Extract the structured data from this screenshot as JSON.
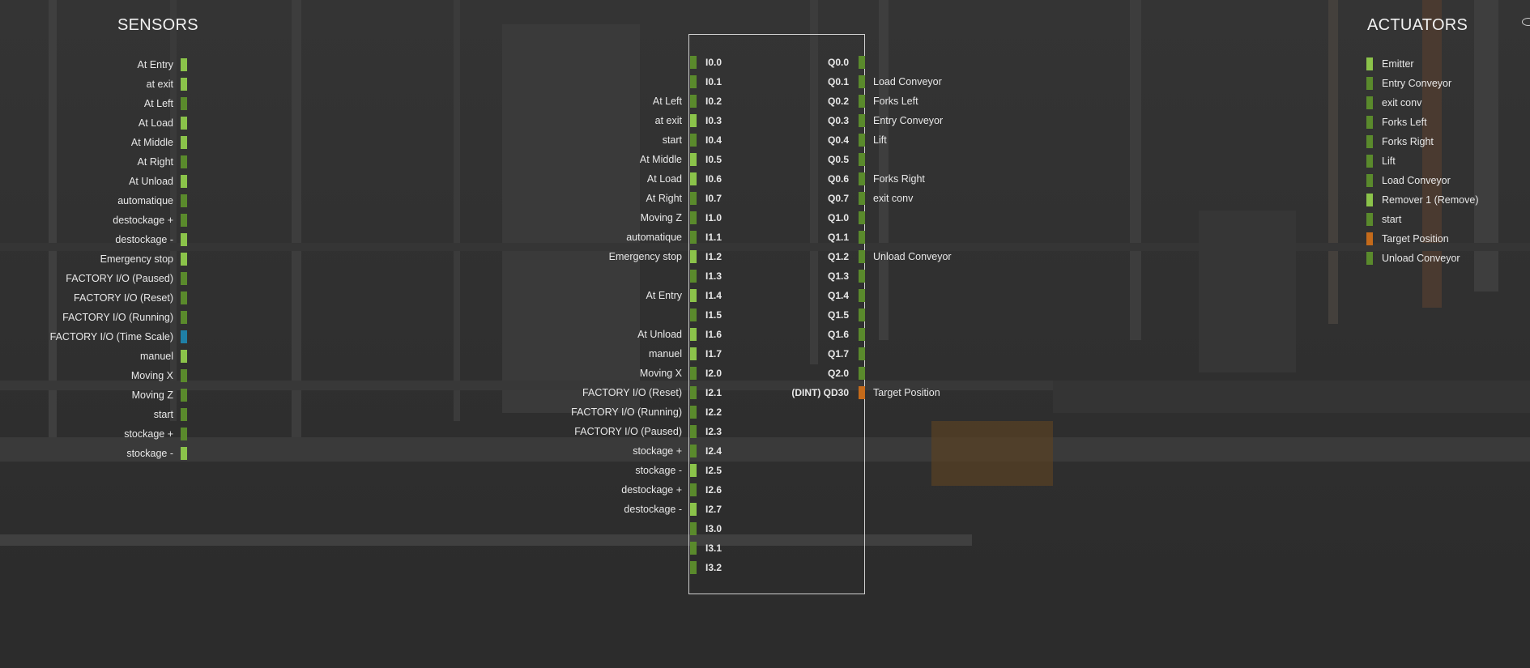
{
  "colors": {
    "on": "#8bc34a",
    "off": "#5a8a2c",
    "analog_orange": "#c46a1a",
    "analog_blue": "#1f7fa6"
  },
  "sensors": {
    "title": "SENSORS",
    "items": [
      {
        "label": "At Entry",
        "state": "on"
      },
      {
        "label": "at exit",
        "state": "on"
      },
      {
        "label": "At Left",
        "state": "off"
      },
      {
        "label": "At Load",
        "state": "on"
      },
      {
        "label": "At Middle",
        "state": "on"
      },
      {
        "label": "At Right",
        "state": "off"
      },
      {
        "label": "At Unload",
        "state": "on"
      },
      {
        "label": "automatique",
        "state": "off"
      },
      {
        "label": "destockage +",
        "state": "off"
      },
      {
        "label": "destockage -",
        "state": "on"
      },
      {
        "label": "Emergency stop",
        "state": "on"
      },
      {
        "label": "FACTORY I/O (Paused)",
        "state": "off"
      },
      {
        "label": "FACTORY I/O (Reset)",
        "state": "off"
      },
      {
        "label": "FACTORY I/O (Running)",
        "state": "off"
      },
      {
        "label": "FACTORY I/O (Time Scale)",
        "state": "blue"
      },
      {
        "label": "manuel",
        "state": "on"
      },
      {
        "label": "Moving X",
        "state": "off"
      },
      {
        "label": "Moving Z",
        "state": "off"
      },
      {
        "label": "start",
        "state": "off"
      },
      {
        "label": "stockage +",
        "state": "off"
      },
      {
        "label": "stockage -",
        "state": "on"
      }
    ]
  },
  "actuators": {
    "title": "ACTUATORS",
    "items": [
      {
        "label": "Emitter",
        "state": "on"
      },
      {
        "label": "Entry Conveyor",
        "state": "off"
      },
      {
        "label": "exit conv",
        "state": "off"
      },
      {
        "label": "Forks Left",
        "state": "off"
      },
      {
        "label": "Forks Right",
        "state": "off"
      },
      {
        "label": "Lift",
        "state": "off"
      },
      {
        "label": "Load Conveyor",
        "state": "off"
      },
      {
        "label": "Remover 1 (Remove)",
        "state": "on"
      },
      {
        "label": "start",
        "state": "off"
      },
      {
        "label": "Target Position",
        "state": "orange"
      },
      {
        "label": "Unload Conveyor",
        "state": "off"
      }
    ]
  },
  "inputs": [
    {
      "label": "",
      "addr": "I0.0",
      "state": "off"
    },
    {
      "label": "",
      "addr": "I0.1",
      "state": "off"
    },
    {
      "label": "At Left",
      "addr": "I0.2",
      "state": "off"
    },
    {
      "label": "at exit",
      "addr": "I0.3",
      "state": "on"
    },
    {
      "label": "start",
      "addr": "I0.4",
      "state": "off"
    },
    {
      "label": "At Middle",
      "addr": "I0.5",
      "state": "on"
    },
    {
      "label": "At Load",
      "addr": "I0.6",
      "state": "on"
    },
    {
      "label": "At Right",
      "addr": "I0.7",
      "state": "off"
    },
    {
      "label": "Moving Z",
      "addr": "I1.0",
      "state": "off"
    },
    {
      "label": "automatique",
      "addr": "I1.1",
      "state": "off"
    },
    {
      "label": "Emergency stop",
      "addr": "I1.2",
      "state": "on"
    },
    {
      "label": "",
      "addr": "I1.3",
      "state": "off"
    },
    {
      "label": "At Entry",
      "addr": "I1.4",
      "state": "on"
    },
    {
      "label": "",
      "addr": "I1.5",
      "state": "off"
    },
    {
      "label": "At Unload",
      "addr": "I1.6",
      "state": "on"
    },
    {
      "label": "manuel",
      "addr": "I1.7",
      "state": "on"
    },
    {
      "label": "Moving X",
      "addr": "I2.0",
      "state": "off"
    },
    {
      "label": "FACTORY I/O (Reset)",
      "addr": "I2.1",
      "state": "off"
    },
    {
      "label": "FACTORY I/O (Running)",
      "addr": "I2.2",
      "state": "off"
    },
    {
      "label": "FACTORY I/O (Paused)",
      "addr": "I2.3",
      "state": "off"
    },
    {
      "label": "stockage +",
      "addr": "I2.4",
      "state": "off"
    },
    {
      "label": "stockage -",
      "addr": "I2.5",
      "state": "on"
    },
    {
      "label": "destockage +",
      "addr": "I2.6",
      "state": "off"
    },
    {
      "label": "destockage -",
      "addr": "I2.7",
      "state": "on"
    },
    {
      "label": "",
      "addr": "I3.0",
      "state": "off"
    },
    {
      "label": "",
      "addr": "I3.1",
      "state": "off"
    },
    {
      "label": "",
      "addr": "I3.2",
      "state": "off"
    }
  ],
  "outputs": [
    {
      "addr": "Q0.0",
      "label": "",
      "state": "off"
    },
    {
      "addr": "Q0.1",
      "label": "Load Conveyor",
      "state": "off"
    },
    {
      "addr": "Q0.2",
      "label": "Forks Left",
      "state": "off"
    },
    {
      "addr": "Q0.3",
      "label": "Entry Conveyor",
      "state": "off"
    },
    {
      "addr": "Q0.4",
      "label": "Lift",
      "state": "off"
    },
    {
      "addr": "Q0.5",
      "label": "",
      "state": "off"
    },
    {
      "addr": "Q0.6",
      "label": "Forks Right",
      "state": "off"
    },
    {
      "addr": "Q0.7",
      "label": "exit conv",
      "state": "off"
    },
    {
      "addr": "Q1.0",
      "label": "",
      "state": "off"
    },
    {
      "addr": "Q1.1",
      "label": "",
      "state": "off"
    },
    {
      "addr": "Q1.2",
      "label": "Unload Conveyor",
      "state": "off"
    },
    {
      "addr": "Q1.3",
      "label": "",
      "state": "off"
    },
    {
      "addr": "Q1.4",
      "label": "",
      "state": "off"
    },
    {
      "addr": "Q1.5",
      "label": "",
      "state": "off"
    },
    {
      "addr": "Q1.6",
      "label": "",
      "state": "off"
    },
    {
      "addr": "Q1.7",
      "label": "",
      "state": "off"
    },
    {
      "addr": "Q2.0",
      "label": "",
      "state": "off"
    },
    {
      "addr": "(DINT) QD30",
      "label": "Target Position",
      "state": "orange"
    }
  ]
}
